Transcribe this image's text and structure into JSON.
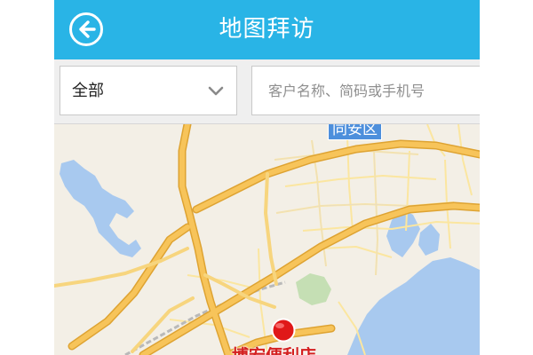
{
  "header": {
    "title": "地图拜访",
    "back_icon": "arrow-left-circle-icon"
  },
  "filter": {
    "selected": "全部",
    "dropdown_icon": "chevron-down-icon",
    "search_placeholder": "客户名称、简码或手机号"
  },
  "map": {
    "district_label": "同安区",
    "marker_label": "博宏便利店",
    "marker_icon": "map-pin-icon"
  },
  "colors": {
    "header": "#29b4e6",
    "road_major": "#f7c45a",
    "road_minor": "#fbe6a0",
    "water": "#a8c9ef",
    "park": "#c5dfb4",
    "marker": "#e01818",
    "district_badge": "#4d8fdc"
  }
}
